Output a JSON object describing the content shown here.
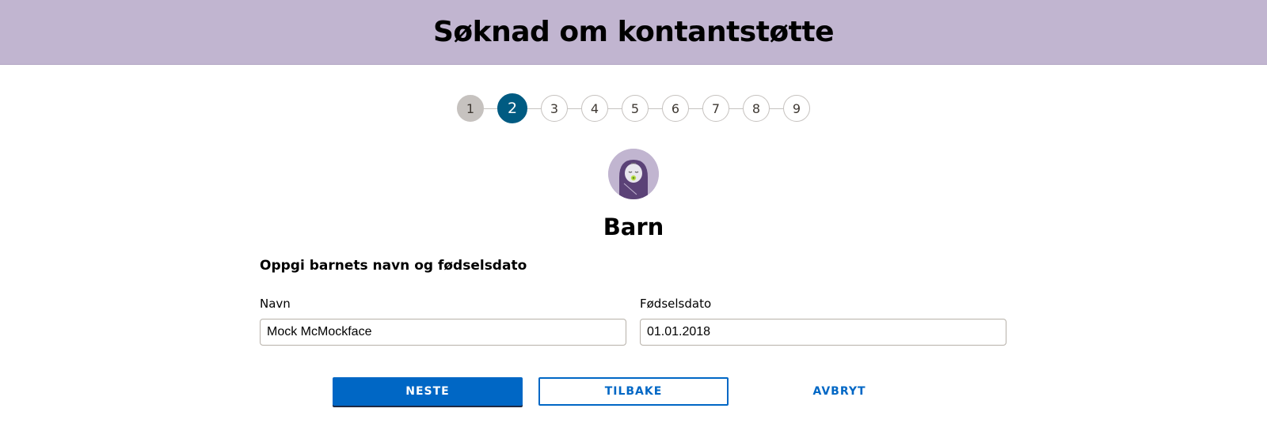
{
  "header": {
    "title": "Søknad om kontantstøtte"
  },
  "stepper": {
    "current": 2,
    "steps": [
      {
        "label": "1",
        "state": "done"
      },
      {
        "label": "2",
        "state": "active"
      },
      {
        "label": "3",
        "state": "todo"
      },
      {
        "label": "4",
        "state": "todo"
      },
      {
        "label": "5",
        "state": "todo"
      },
      {
        "label": "6",
        "state": "todo"
      },
      {
        "label": "7",
        "state": "todo"
      },
      {
        "label": "8",
        "state": "todo"
      },
      {
        "label": "9",
        "state": "todo"
      }
    ]
  },
  "section": {
    "icon": "baby-icon",
    "title": "Barn"
  },
  "form": {
    "question": "Oppgi barnets navn og fødselsdato",
    "name_label": "Navn",
    "name_value": "Mock McMockface",
    "birthdate_label": "Fødselsdato",
    "birthdate_value": "01.01.2018"
  },
  "actions": {
    "next_label": "NESTE",
    "back_label": "TILBAKE",
    "cancel_label": "AVBRYT"
  },
  "colors": {
    "banner": "#c1b5d0",
    "step_active": "#005b82",
    "step_done": "#c6c2bf",
    "primary": "#0067c5"
  }
}
